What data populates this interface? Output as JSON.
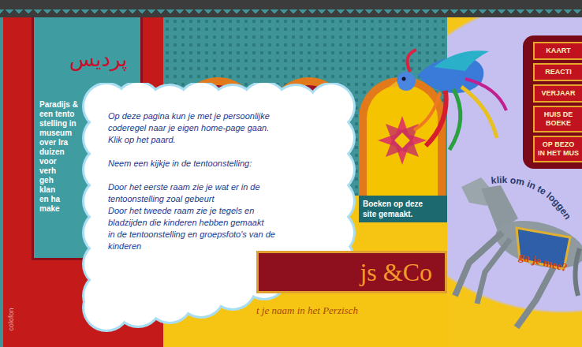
{
  "logo": "پردیس",
  "intro": {
    "lines": [
      "Paradijs &",
      "een tento",
      "stelling in",
      "museum",
      "over Ira",
      "duizen",
      "voor",
      "verh",
      "geh",
      "klan",
      "en ha",
      "make"
    ]
  },
  "cloud": {
    "paragraphs": [
      [
        "Op deze pagina kun je met je persoonlijke",
        "coderegel naar je eigen home-page gaan.",
        "Klik op het paard."
      ],
      [
        "Neem een kijkje in de tentoonstelling:"
      ],
      [
        "Door het eerste raam zie je wat er in de",
        "tentoonstelling zoal gebeurt",
        "Door het tweede raam zie je tegels en",
        "bladzijden die kinderen hebben gemaakt",
        "in de tentoonstelling en groepsfoto's van de",
        "kinderen"
      ]
    ]
  },
  "books_caption": {
    "lines": [
      "Boeken op deze",
      "site gemaakt."
    ]
  },
  "banner": {
    "title": "js &Co",
    "subtitle": "t je naam in het Perzisch"
  },
  "menu": [
    {
      "lines": [
        "KAART"
      ]
    },
    {
      "lines": [
        "REACTI"
      ]
    },
    {
      "lines": [
        "VERJAAR"
      ]
    },
    {
      "lines": [
        "HUIS DE",
        "BOEKE"
      ]
    },
    {
      "lines": [
        "OP BEZO",
        "IN HET MUS"
      ]
    }
  ],
  "horse": {
    "arc_text": "klik om in te loggen",
    "question": "ga je mee?"
  },
  "colofon": "colofon"
}
